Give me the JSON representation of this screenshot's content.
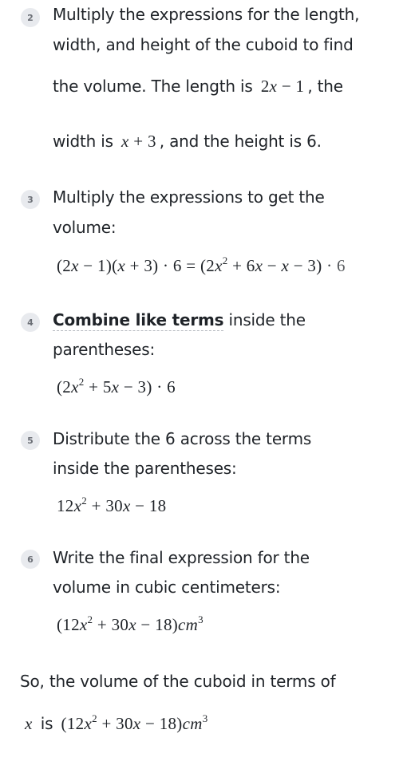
{
  "steps": [
    {
      "number": "2",
      "lines": [
        "Multiply the expressions for the length,",
        "width, and height of the cuboid to find"
      ],
      "line3_before": "the volume. The length is",
      "line3_math": "2x − 1",
      "line3_after": ", the",
      "line4_before": "width is",
      "line4_math": "x + 3",
      "line4_after": ", and the height is 6."
    },
    {
      "number": "3",
      "lines": [
        "Multiply the expressions to get the",
        "volume:"
      ],
      "equation": "(2x − 1)(x + 3) · 6 = (2x² + 6x − x − 3) · 6"
    },
    {
      "number": "4",
      "concept_link": "Combine like terms",
      "line1_after": " inside the",
      "line2": "parentheses:",
      "equation": "(2x² + 5x − 3) · 6"
    },
    {
      "number": "5",
      "lines": [
        "Distribute the 6 across the terms",
        "inside the parentheses:"
      ],
      "equation": "12x² + 30x − 18"
    },
    {
      "number": "6",
      "lines": [
        "Write the final expression for the",
        "volume in cubic centimeters:"
      ],
      "equation": "(12x² + 30x − 18)cm³"
    }
  ],
  "conclusion": {
    "line1": "So, the volume of the cuboid in terms of",
    "var": "x",
    "is_word": "is",
    "result": "(12x² + 30x − 18)cm³"
  },
  "math_parts": {
    "two": "2",
    "x": "x",
    "minus": "−",
    "plus": "+",
    "one": "1",
    "three": "3",
    "six": "6",
    "five": "5",
    "twelve": "12",
    "thirty": "30",
    "eighteen": "18",
    "dot": "·",
    "eq": "=",
    "sq": "2",
    "cube": "3",
    "cm": "cm",
    "lp": "(",
    "rp": ")"
  }
}
